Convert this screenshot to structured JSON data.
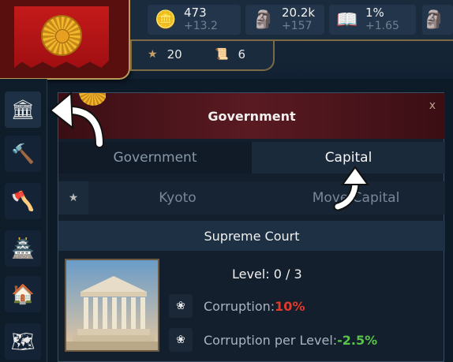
{
  "resources": [
    {
      "icon": "gold-coins-icon",
      "value": "473",
      "delta": "+13.2"
    },
    {
      "icon": "population-icon",
      "value": "20.2k",
      "delta": "+157"
    },
    {
      "icon": "book-icon",
      "value": "1%",
      "delta": "+1.65"
    }
  ],
  "sub_resources": [
    {
      "icon": "star-icon",
      "value": "20"
    },
    {
      "icon": "scroll-icon",
      "value": "6"
    }
  ],
  "sidebar": [
    "capitol-icon",
    "gavel-icon",
    "axe-icon",
    "tower-icon",
    "house-icon",
    "map-icon"
  ],
  "panel": {
    "title": "Government",
    "close": "x",
    "tabs": [
      "Government",
      "Capital"
    ],
    "capital_name": "Kyoto",
    "move_capital": "Move Capital",
    "section_title": "Supreme Court",
    "level": "Level: 0 / 3",
    "corruption_label": "Corruption: ",
    "corruption_value": "10%",
    "corruption_per_level_label": "Corruption per Level: ",
    "corruption_per_level_value": "-2.5%"
  },
  "colors": {
    "accent_red": "#e23a2a",
    "accent_green": "#58c34a",
    "gold_border": "#b79b5a"
  }
}
